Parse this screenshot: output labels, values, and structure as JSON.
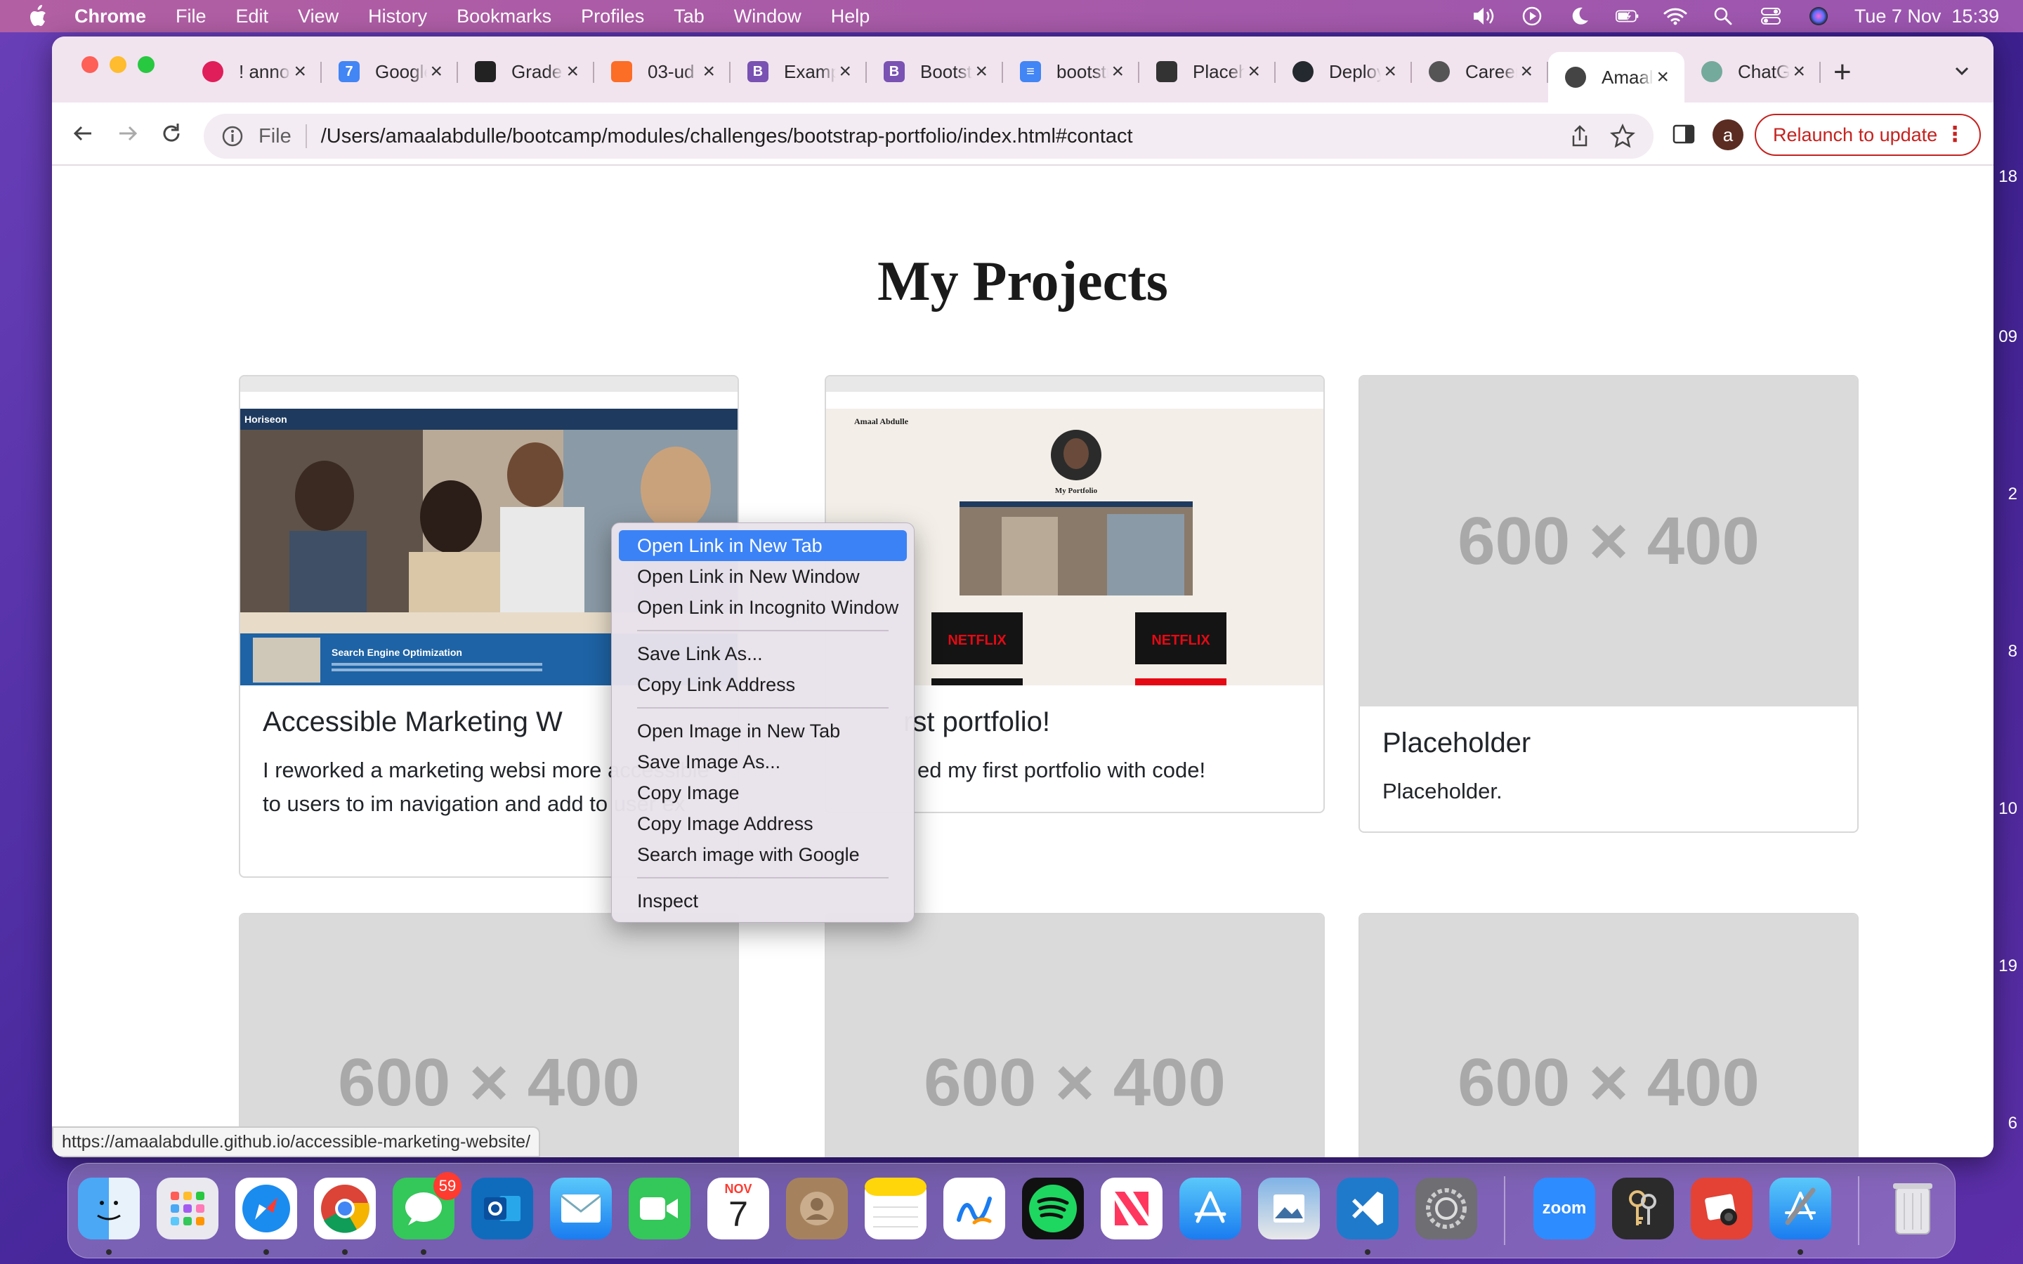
{
  "menubar": {
    "app_name": "Chrome",
    "items": [
      "File",
      "Edit",
      "View",
      "History",
      "Bookmarks",
      "Profiles",
      "Tab",
      "Window",
      "Help"
    ],
    "clock": "Tue 7 Nov  15:39"
  },
  "tabs": [
    {
      "title": "! announcements",
      "favicon": "slack-icon",
      "color": "#e01e5a"
    },
    {
      "title": "Google Calendar",
      "favicon": "calendar-icon",
      "color": "#4285f4"
    },
    {
      "title": "Grades",
      "favicon": "edx-icon",
      "color": "#222222"
    },
    {
      "title": "03-ud",
      "favicon": "gitlab-icon",
      "color": "#fc6d26"
    },
    {
      "title": "Examples",
      "favicon": "bootstrap-icon",
      "color": "#7952b3"
    },
    {
      "title": "Bootstrap",
      "favicon": "bootstrap-icon",
      "color": "#7952b3"
    },
    {
      "title": "bootstrap",
      "favicon": "docs-icon",
      "color": "#4285f4"
    },
    {
      "title": "Placeholder",
      "favicon": "placeholder-icon",
      "color": "#333333"
    },
    {
      "title": "Deploy",
      "favicon": "github-icon",
      "color": "#24292f"
    },
    {
      "title": "Careers",
      "favicon": "careers-icon",
      "color": "#555555"
    },
    {
      "title": "Amaal",
      "favicon": "globe-icon",
      "color": "#444444",
      "active": true
    },
    {
      "title": "ChatGPT",
      "favicon": "chatgpt-icon",
      "color": "#74aa9c"
    }
  ],
  "toolbar": {
    "scheme": "File",
    "url": "/Users/amaalabdulle/bootcamp/modules/challenges/bootstrap-portfolio/index.html#contact",
    "profile_initial": "a",
    "relaunch_label": "Relaunch to update"
  },
  "page": {
    "title": "My Projects",
    "cards": [
      {
        "title": "Accessible Marketing W",
        "text": "I reworked a marketing websi more accessible to users to im navigation and add to user ex"
      },
      {
        "title": "rst portfolio!",
        "text": "ed my first portfolio with code!"
      },
      {
        "title": "Placeholder",
        "text": "Placeholder.",
        "image_text": "600 × 400"
      }
    ],
    "placeholder_text": "600 × 400",
    "thumb1": {
      "brand": "Horiseon",
      "banner": "Search Engine Optimization"
    },
    "thumb2": {
      "author": "Amaal Abdulle",
      "heading": "My Portfolio",
      "netflix": "NETFLIX"
    }
  },
  "status_url": "https://amaalabdulle.github.io/accessible-marketing-website/",
  "context_menu": {
    "groups": [
      [
        "Open Link in New Tab",
        "Open Link in New Window",
        "Open Link in Incognito Window"
      ],
      [
        "Save Link As...",
        "Copy Link Address"
      ],
      [
        "Open Image in New Tab",
        "Save Image As...",
        "Copy Image",
        "Copy Image Address",
        "Search image with Google"
      ],
      [
        "Inspect"
      ]
    ]
  },
  "dock": {
    "messages_badge": "59",
    "calendar_month": "NOV",
    "calendar_day": "7",
    "zoom_label": "zoom"
  },
  "edge_numbers": [
    "18",
    "09",
    "2",
    "8",
    "10",
    "19",
    "6"
  ]
}
